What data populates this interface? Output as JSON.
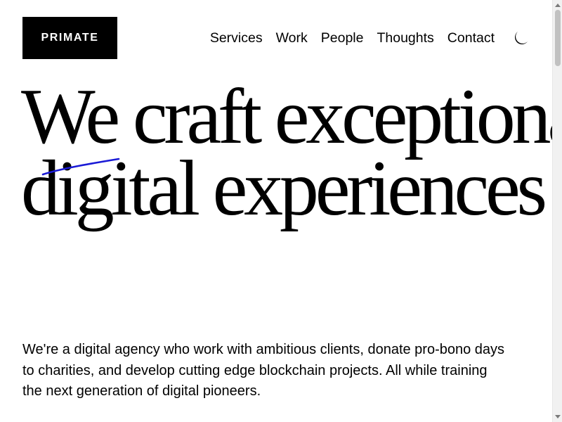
{
  "header": {
    "logo_text": "PRIMATE",
    "nav": [
      {
        "label": "Services"
      },
      {
        "label": "Work"
      },
      {
        "label": "People"
      },
      {
        "label": "Thoughts"
      },
      {
        "label": "Contact"
      }
    ],
    "theme_toggle_icon": "moon-icon"
  },
  "hero": {
    "line1": "We craft exceptional",
    "line2": "digital experiences",
    "accent_color": "#1a1ad6"
  },
  "intro": {
    "text": "We're a digital agency who work with ambitious clients, donate pro-bono days to charities, and develop cutting edge blockchain projects. All while training the next generation of digital pioneers."
  },
  "colors": {
    "background": "#ffffff",
    "text": "#000000",
    "logo_background": "#000000",
    "logo_text": "#ffffff"
  }
}
